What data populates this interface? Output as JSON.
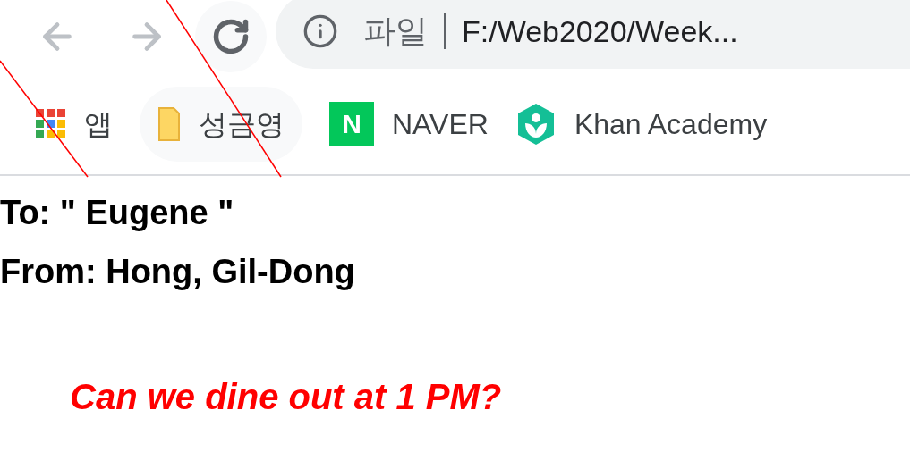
{
  "address_bar": {
    "scheme_label": "파일",
    "url": "F:/Web2020/Week..."
  },
  "bookmarks": [
    {
      "kind": "apps",
      "label": "앱"
    },
    {
      "kind": "folder",
      "label": "성금영"
    },
    {
      "kind": "naver",
      "label": "NAVER",
      "icon_text": "N"
    },
    {
      "kind": "khan",
      "label": "Khan Academy"
    }
  ],
  "content": {
    "to_line": "To: \" Eugene \"",
    "from_line": "From: Hong, Gil-Dong",
    "message": "Can we dine out at 1 PM?"
  }
}
